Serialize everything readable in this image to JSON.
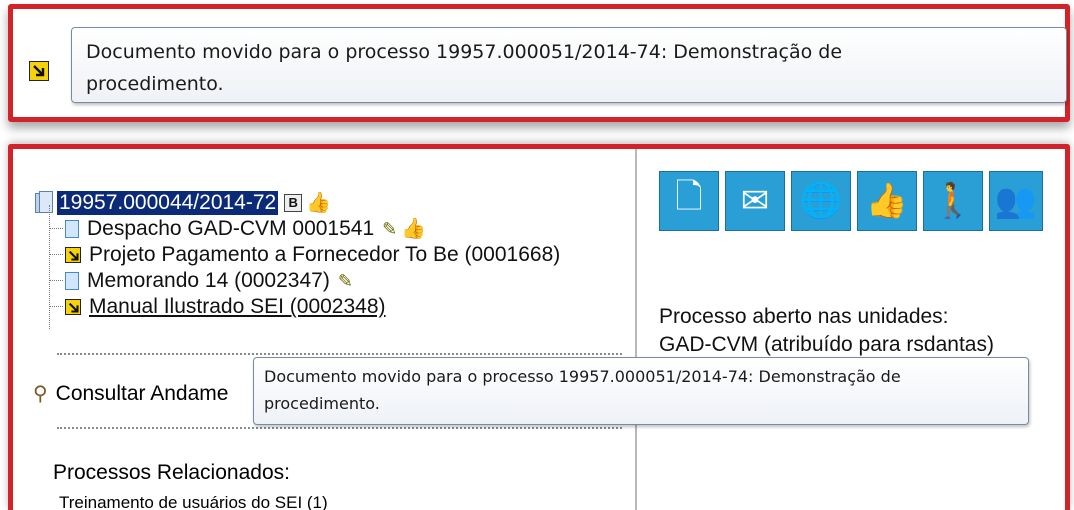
{
  "callout": {
    "message_line1": "Documento movido para o processo 19957.000051/2014-74: Demonstração de",
    "message_line2": "procedimento."
  },
  "tree": {
    "process_number": "19957.000044/2014-72",
    "process_badge": "B",
    "documents": [
      {
        "label": "Despacho GAD-CVM 0001541",
        "icon": "document-icon",
        "has_pencil": true,
        "has_thumb": true
      },
      {
        "label": "Projeto Pagamento a Fornecedor To Be (0001668)",
        "icon": "document-moved-icon"
      },
      {
        "label": "Memorando 14 (0002347)",
        "icon": "document-icon",
        "has_pencil": true
      },
      {
        "label": "Manual Ilustrado SEI (0002348)",
        "icon": "document-moved-icon",
        "underlined": true
      }
    ]
  },
  "consult": {
    "label": "Consultar Andame"
  },
  "related": {
    "title": "Processos Relacionados:",
    "items": [
      "Treinamento de usuários do SEI (1)"
    ]
  },
  "toolbar": {
    "icons": [
      "new-document-icon",
      "send-process-icon",
      "update-process-icon",
      "thumbs-up-icon",
      "assign-process-icon",
      "users-icon"
    ]
  },
  "status": {
    "title": "Processo aberto nas unidades:",
    "unit": "GAD-CVM (atribuído para rsdantas)"
  },
  "tooltip": {
    "line1": "Documento movido para o processo 19957.000051/2014-74: Demonstração de",
    "line2": "procedimento."
  },
  "colors": {
    "highlight_border": "#d2232a",
    "selected_process_bg": "#0b2a78",
    "toolbar_button": "#2a9fd6"
  }
}
